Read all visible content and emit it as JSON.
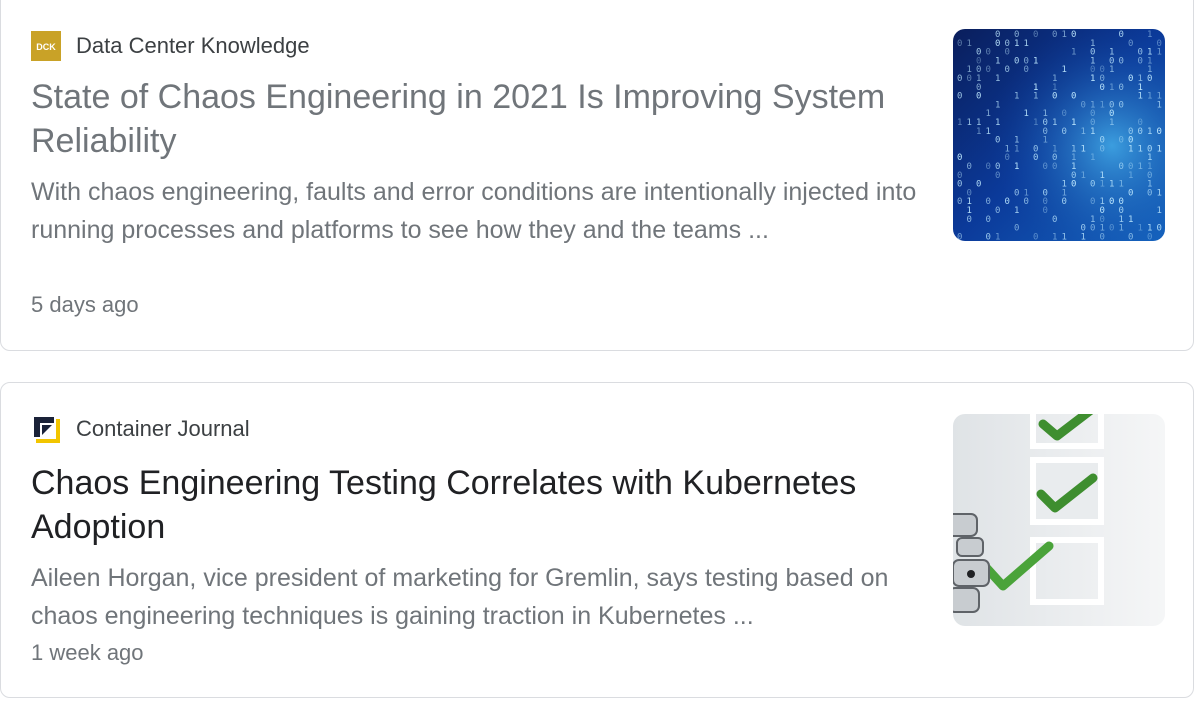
{
  "articles": [
    {
      "source": "Data Center Knowledge",
      "favicon_text": "DCK",
      "favicon_icon": "dck-logo-icon",
      "favicon_color": "#c9a227",
      "headline": "State of Chaos Engineering in 2021 Is Improving System Reliability",
      "snippet": "With chaos engineering, faults and error conditions are intentionally injected into running processes and platforms to see how they and the teams ...",
      "timestamp": "5 days ago",
      "thumbnail_icon": "binary-data-image"
    },
    {
      "source": "Container Journal",
      "favicon_icon": "container-journal-logo-icon",
      "favicon_colors": [
        "#1a2238",
        "#f2c500"
      ],
      "headline": "Chaos Engineering Testing Correlates with Kubernetes Adoption",
      "snippet": "Aileen Horgan, vice president of marketing for Gremlin, says testing based on chaos engineering techniques is gaining traction in Kubernetes ...",
      "timestamp": "1 week ago",
      "thumbnail_icon": "checklist-image"
    }
  ]
}
